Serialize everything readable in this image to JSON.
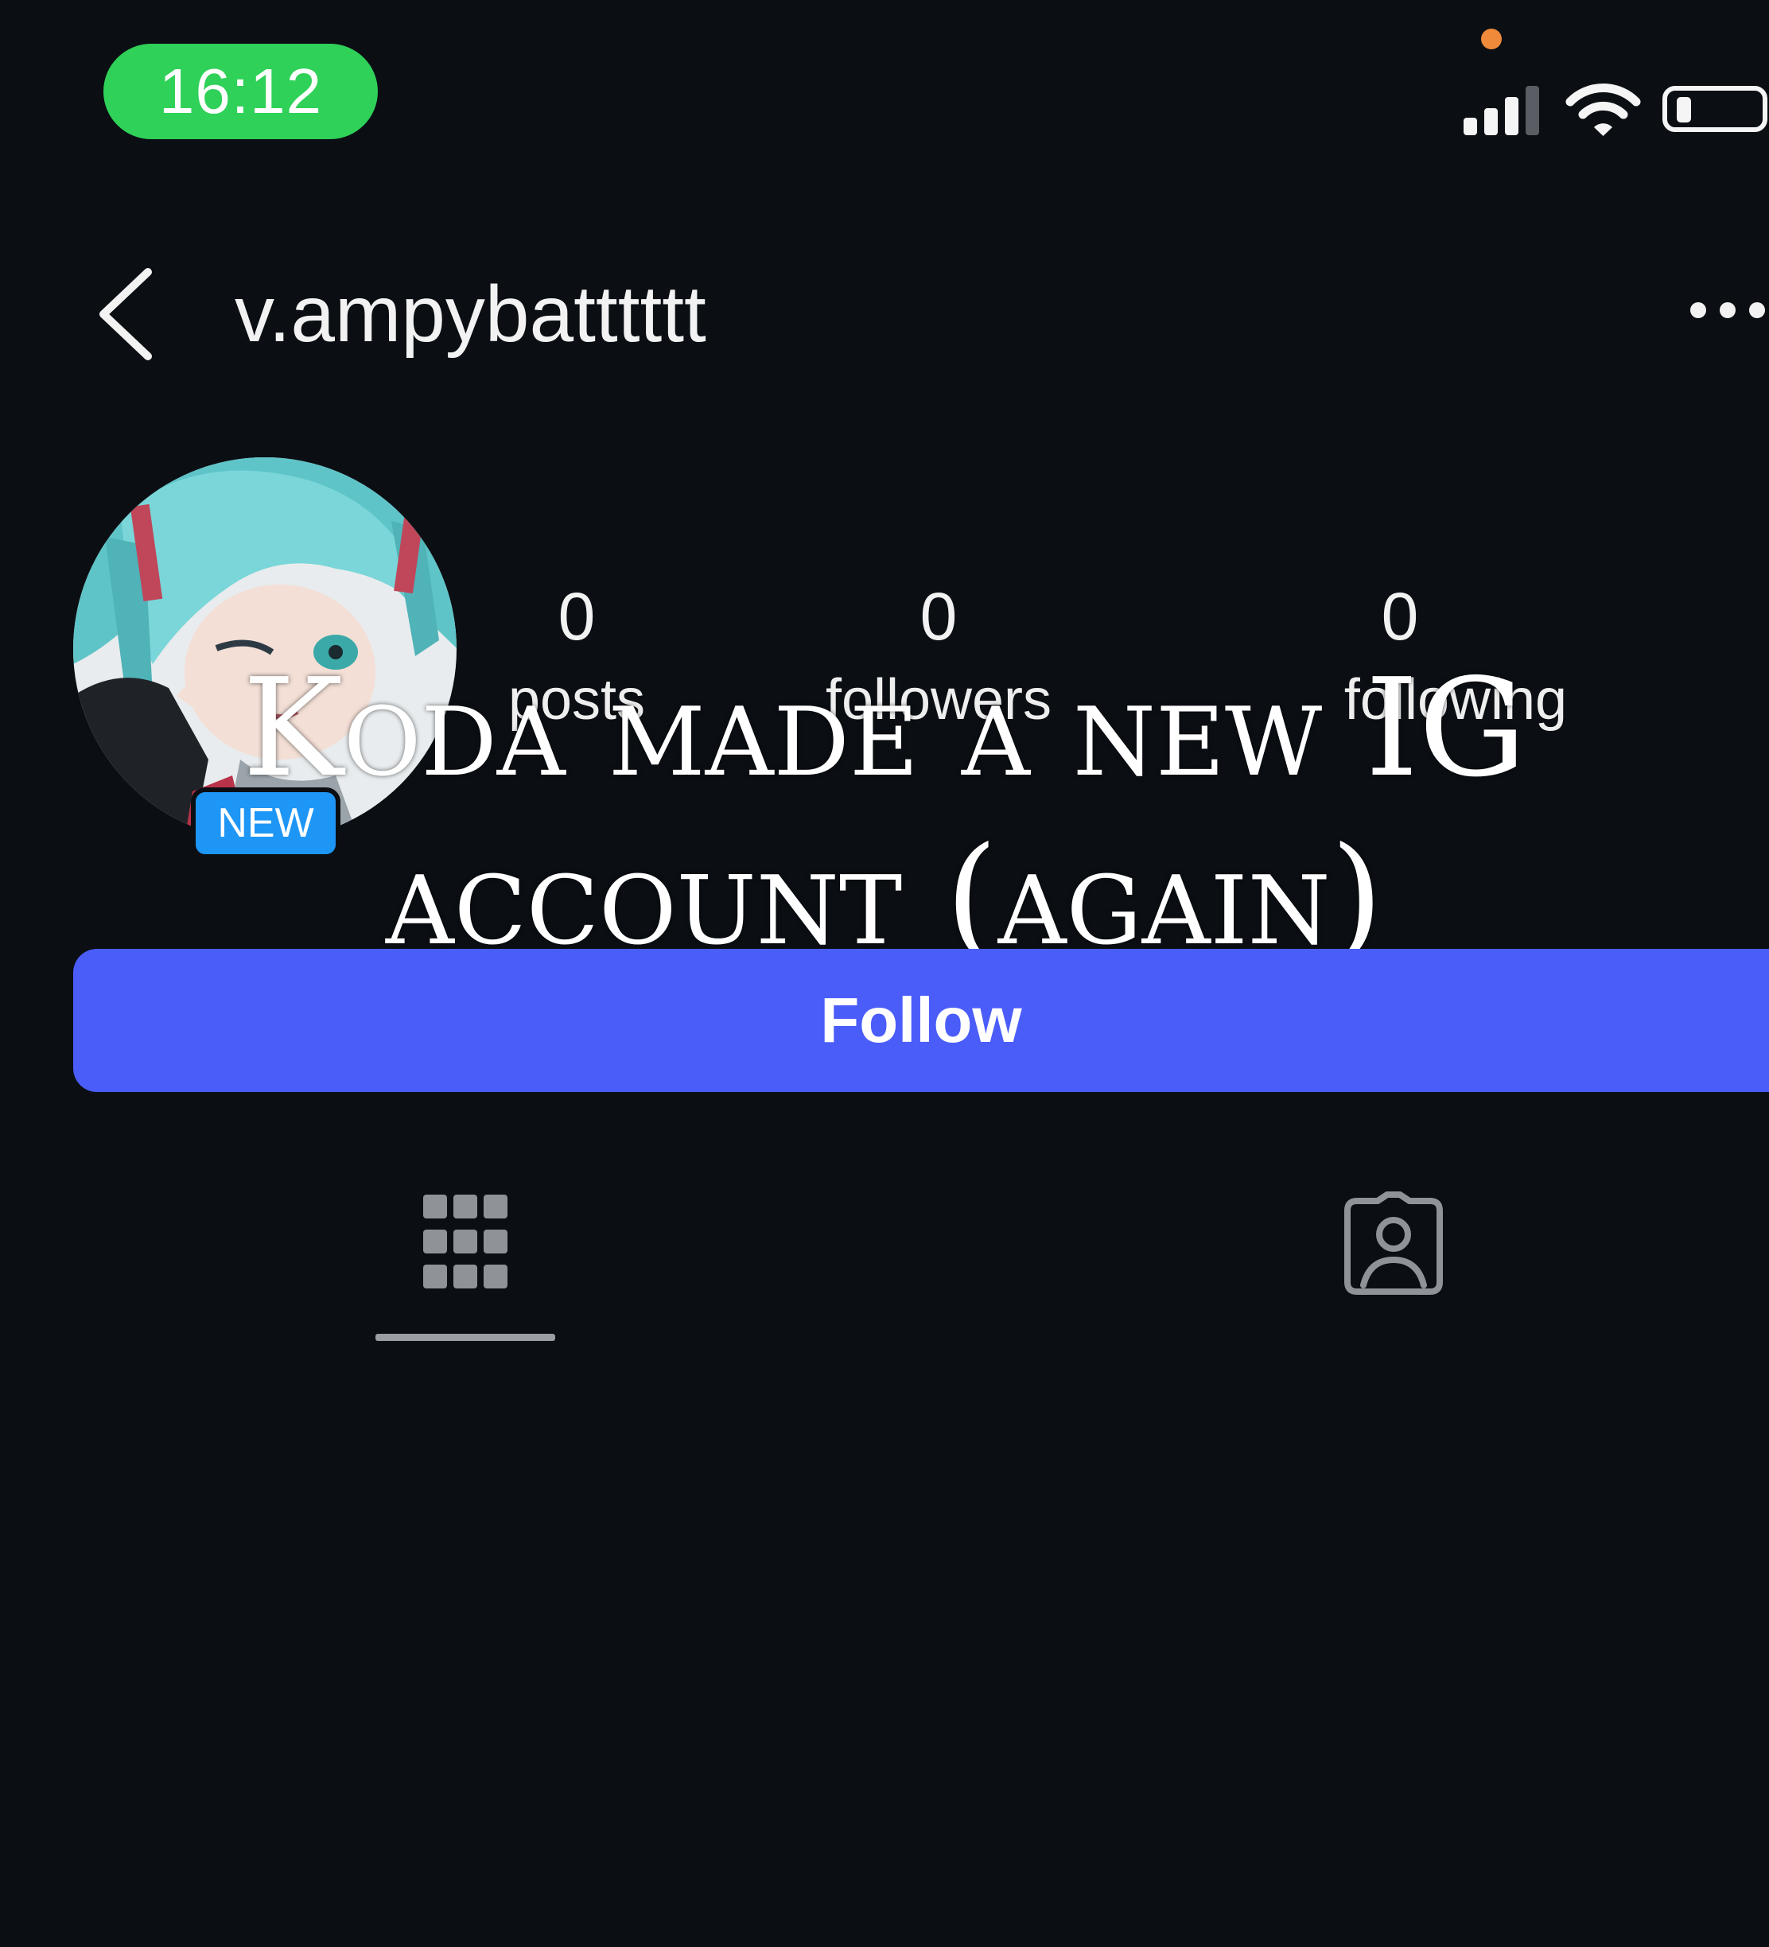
{
  "status_bar": {
    "time": "16:12",
    "icons": [
      "signal-icon",
      "wifi-icon",
      "battery-icon"
    ]
  },
  "header": {
    "username": "v.ampybatttttt",
    "back_icon": "back-chevron-icon",
    "more_icon": "more-horizontal-icon"
  },
  "profile": {
    "avatar": "profile-avatar",
    "badge": "NEW",
    "stats": [
      {
        "value": "0",
        "label": "posts"
      },
      {
        "value": "0",
        "label": "followers"
      },
      {
        "value": "0",
        "label": "following"
      }
    ]
  },
  "caption": {
    "line1": "Koda made a new IG",
    "line2": "account (again)"
  },
  "actions": {
    "follow_label": "Follow"
  },
  "tabs": [
    {
      "icon": "grid-icon",
      "active": true
    },
    {
      "icon": "tagged-person-icon",
      "active": false
    }
  ],
  "colors": {
    "background": "#0b0f14",
    "time_pill": "#2fd158",
    "follow_button": "#4a5df9",
    "badge": "#1e96f5",
    "mic_indicator": "#ee8a3a"
  }
}
